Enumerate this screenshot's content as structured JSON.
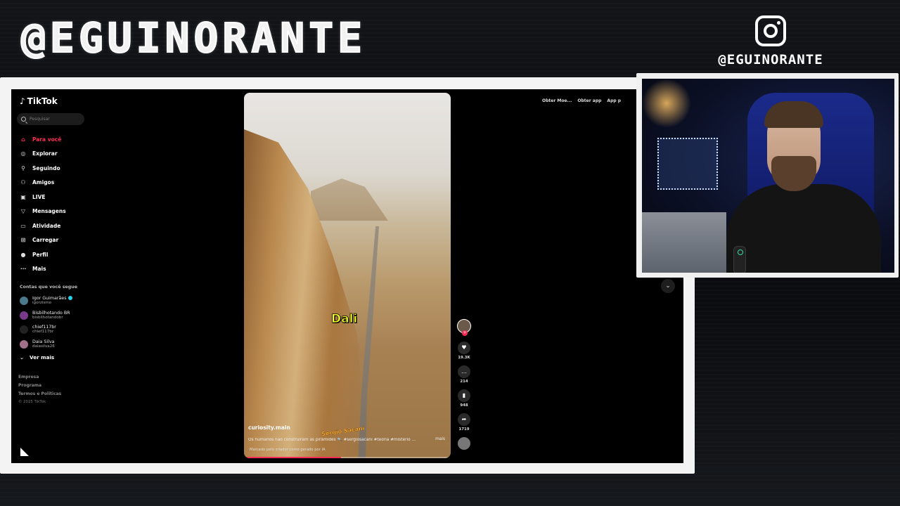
{
  "overlay": {
    "brand_title": "@EGUINORANTE",
    "instagram_handle": "@EGUINORANTE"
  },
  "tiktok": {
    "logo": "TikTok",
    "search_placeholder": "Pesquisar",
    "nav": [
      {
        "label": "Para você",
        "icon": "home-icon",
        "active": true
      },
      {
        "label": "Explorar",
        "icon": "compass-icon"
      },
      {
        "label": "Seguindo",
        "icon": "following-icon"
      },
      {
        "label": "Amigos",
        "icon": "friends-icon"
      },
      {
        "label": "LIVE",
        "icon": "live-icon"
      },
      {
        "label": "Mensagens",
        "icon": "messages-icon"
      },
      {
        "label": "Atividade",
        "icon": "activity-icon"
      },
      {
        "label": "Carregar",
        "icon": "upload-icon"
      },
      {
        "label": "Perfil",
        "icon": "profile-icon"
      },
      {
        "label": "Mais",
        "icon": "more-icon"
      }
    ],
    "following_title": "Contas que você segue",
    "following": [
      {
        "name": "Igor Guimarães",
        "handle": "igorzismo",
        "verified": true
      },
      {
        "name": "Bisbilhotando BR",
        "handle": "bisbilhotandobr"
      },
      {
        "name": "chief117br",
        "handle": "chief117br"
      },
      {
        "name": "Daia Silva",
        "handle": "daiasilva26"
      }
    ],
    "see_more": "Ver mais",
    "footer": [
      "Empresa",
      "Programa",
      "Termos e Políticas"
    ],
    "copyright": "© 2025 TikTok",
    "topbar": [
      "Obter Moe...",
      "Obter app",
      "App p"
    ],
    "video": {
      "caption_word": "Dali",
      "author": "curiosity.main",
      "description": "Os humanos não construíram as pirâmides 🔍 #sergiosacani #teoria #misterio ...",
      "more": "mais",
      "ai_label": "Marcado pelo criador como gerado por IA",
      "sticker": "Sergio Sacani",
      "progress": 0.47
    },
    "stats": {
      "likes": "19.3K",
      "comments": "214",
      "saves": "948",
      "shares": "1719"
    }
  },
  "colors": {
    "accent": "#fe2c55",
    "caption": "#f3ff1a"
  }
}
